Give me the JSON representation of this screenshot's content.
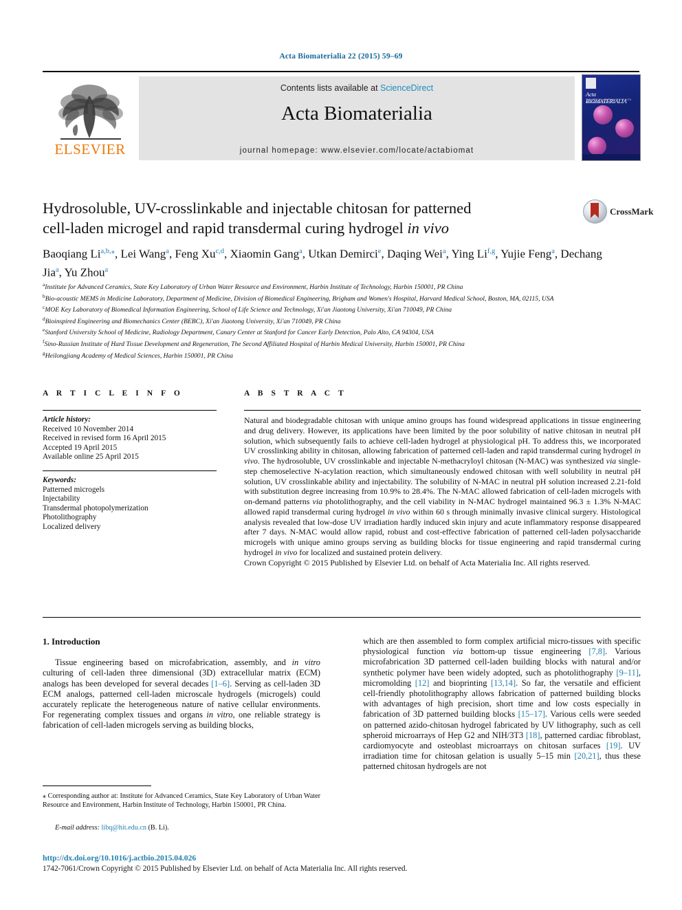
{
  "running_head": "Acta Biomaterialia 22 (2015) 59–69",
  "masthead": {
    "contents_prefix": "Contents lists available at ",
    "sciencedirect": "ScienceDirect",
    "journal_title": "Acta Biomaterialia",
    "homepage": "journal homepage: www.elsevier.com/locate/actabiomat",
    "publisher_wordmark": "ELSEVIER",
    "cover": {
      "title": "Acta BIOMATERIALIA",
      "subtitle": "THE OFFICIAL JOURNAL OF THE ACTA MATERIALIA SOCIETY"
    }
  },
  "crossmark": {
    "label": "CrossMark"
  },
  "article": {
    "title": "Hydrosoluble, UV-crosslinkable and injectable chitosan for patterned cell-laden microgel and rapid transdermal curing hydrogel in vivo",
    "title_line1": "Hydrosoluble, UV-crosslinkable and injectable chitosan for patterned",
    "title_line2_pre": "cell-laden microgel and rapid transdermal curing hydrogel ",
    "title_line2_italic": "in vivo",
    "authors": [
      {
        "name": "Baoqiang Li",
        "sup": "a,b,⁎"
      },
      {
        "name": "Lei Wang",
        "sup": "a"
      },
      {
        "name": "Feng Xu",
        "sup": "c,d"
      },
      {
        "name": "Xiaomin Gang",
        "sup": "a"
      },
      {
        "name": "Utkan Demirci",
        "sup": "e"
      },
      {
        "name": "Daqing Wei",
        "sup": "a"
      },
      {
        "name": "Ying Li",
        "sup": "f,g"
      },
      {
        "name": "Yujie Feng",
        "sup": "a"
      },
      {
        "name": "Dechang Jia",
        "sup": "a"
      },
      {
        "name": "Yu Zhou",
        "sup": "a"
      }
    ],
    "affiliations": [
      {
        "mark": "a",
        "text": "Institute for Advanced Ceramics, State Key Laboratory of Urban Water Resource and Environment, Harbin Institute of Technology, Harbin 150001, PR China"
      },
      {
        "mark": "b",
        "text": "Bio-acoustic MEMS in Medicine Laboratory, Department of Medicine, Division of Biomedical Engineering, Brigham and Women's Hospital, Harvard Medical School, Boston, MA, 02115, USA"
      },
      {
        "mark": "c",
        "text": "MOE Key Laboratory of Biomedical Information Engineering, School of Life Science and Technology, Xi'an Jiaotong University, Xi'an 710049, PR China"
      },
      {
        "mark": "d",
        "text": "Bioinspired Engineering and Biomechanics Center (BEBC), Xi'an Jiaotong University, Xi'an 710049, PR China"
      },
      {
        "mark": "e",
        "text": "Stanford University School of Medicine, Radiology Department, Canary Center at Stanford for Cancer Early Detection, Palo Alto, CA 94304, USA"
      },
      {
        "mark": "f",
        "text": "Sino-Russian Institute of Hard Tissue Development and Regeneration, The Second Affiliated Hospital of Harbin Medical University, Harbin 150001, PR China"
      },
      {
        "mark": "g",
        "text": "Heilongjiang Academy of Medical Sciences, Harbin 150001, PR China"
      }
    ]
  },
  "article_info": {
    "heading": "A R T I C L E  I N F O",
    "history_label": "Article history:",
    "history": [
      "Received 10 November 2014",
      "Received in revised form 16 April 2015",
      "Accepted 19 April 2015",
      "Available online 25 April 2015"
    ],
    "keywords_label": "Keywords:",
    "keywords": [
      "Patterned microgels",
      "Injectability",
      "Transdermal photopolymerization",
      "Photolithography",
      "Localized delivery"
    ]
  },
  "abstract": {
    "heading": "A B S T R A C T",
    "text": "Natural and biodegradable chitosan with unique amino groups has found widespread applications in tissue engineering and drug delivery. However, its applications have been limited by the poor solubility of native chitosan in neutral pH solution, which subsequently fails to achieve cell-laden hydrogel at physiological pH. To address this, we incorporated UV crosslinking ability in chitosan, allowing fabrication of patterned cell-laden and rapid transdermal curing hydrogel in vivo. The hydrosoluble, UV crosslinkable and injectable N-methacryloyl chitosan (N-MAC) was synthesized via single-step chemoselective N-acylation reaction, which simultaneously endowed chitosan with well solubility in neutral pH solution, UV crosslinkable ability and injectability. The solubility of N-MAC in neutral pH solution increased 2.21-fold with substitution degree increasing from 10.9% to 28.4%. The N-MAC allowed fabrication of cell-laden microgels with on-demand patterns via photolithography, and the cell viability in N-MAC hydrogel maintained 96.3 ± 1.3% N-MAC allowed rapid transdermal curing hydrogel in vivo within 60 s through minimally invasive clinical surgery. Histological analysis revealed that low-dose UV irradiation hardly induced skin injury and acute inflammatory response disappeared after 7 days. N-MAC would allow rapid, robust and cost-effective fabrication of patterned cell-laden polysaccharide microgels with unique amino groups serving as building blocks for tissue engineering and rapid transdermal curing hydrogel in vivo for localized and sustained protein delivery.",
    "copyright": "Crown Copyright © 2015 Published by Elsevier Ltd. on behalf of Acta Materialia Inc. All rights reserved."
  },
  "body": {
    "section_heading": "1. Introduction",
    "left_paragraph": "Tissue engineering based on microfabrication, assembly, and in vitro culturing of cell-laden three dimensional (3D) extracellular matrix (ECM) analogs has been developed for several decades [1–6]. Serving as cell-laden 3D ECM analogs, patterned cell-laden microscale hydrogels (microgels) could accurately replicate the heterogeneous nature of native cellular environments. For regenerating complex tissues and organs in vitro, one reliable strategy is fabrication of cell-laden microgels serving as building blocks,",
    "right_paragraph": "which are then assembled to form complex artificial micro-tissues with specific physiological function via bottom-up tissue engineering [7,8]. Various microfabrication 3D patterned cell-laden building blocks with natural and/or synthetic polymer have been widely adopted, such as photolithography [9–11], micromolding [12] and bioprinting [13,14]. So far, the versatile and efficient cell-friendly photolithography allows fabrication of patterned building blocks with advantages of high precision, short time and low costs especially in fabrication of 3D patterned building blocks [15–17]. Various cells were seeded on patterned azido-chitosan hydrogel fabricated by UV lithography, such as cell spheroid microarrays of Hep G2 and NIH/3T3 [18], patterned cardiac fibroblast, cardiomyocyte and osteoblast microarrays on chitosan surfaces [19]. UV irradiation time for chitosan gelation is usually 5–15 min [20,21], thus these patterned chitosan hydrogels are not"
  },
  "footnotes": {
    "corresponding": "Corresponding author at: Institute for Advanced Ceramics, State Key Laboratory of Urban Water Resource and Environment, Harbin Institute of Technology, Harbin 150001, PR China.",
    "email_label": "E-mail address:",
    "email": "libq@hit.edu.cn",
    "email_owner": "(B. Li).",
    "doi": "http://dx.doi.org/10.1016/j.actbio.2015.04.026",
    "issn_line": "1742-7061/Crown Copyright © 2015 Published by Elsevier Ltd. on behalf of Acta Materialia Inc. All rights reserved."
  },
  "colors": {
    "link": "#1f7fad",
    "elsevier_orange": "#ec7a08",
    "banner_bg": "#e3e3e3"
  }
}
